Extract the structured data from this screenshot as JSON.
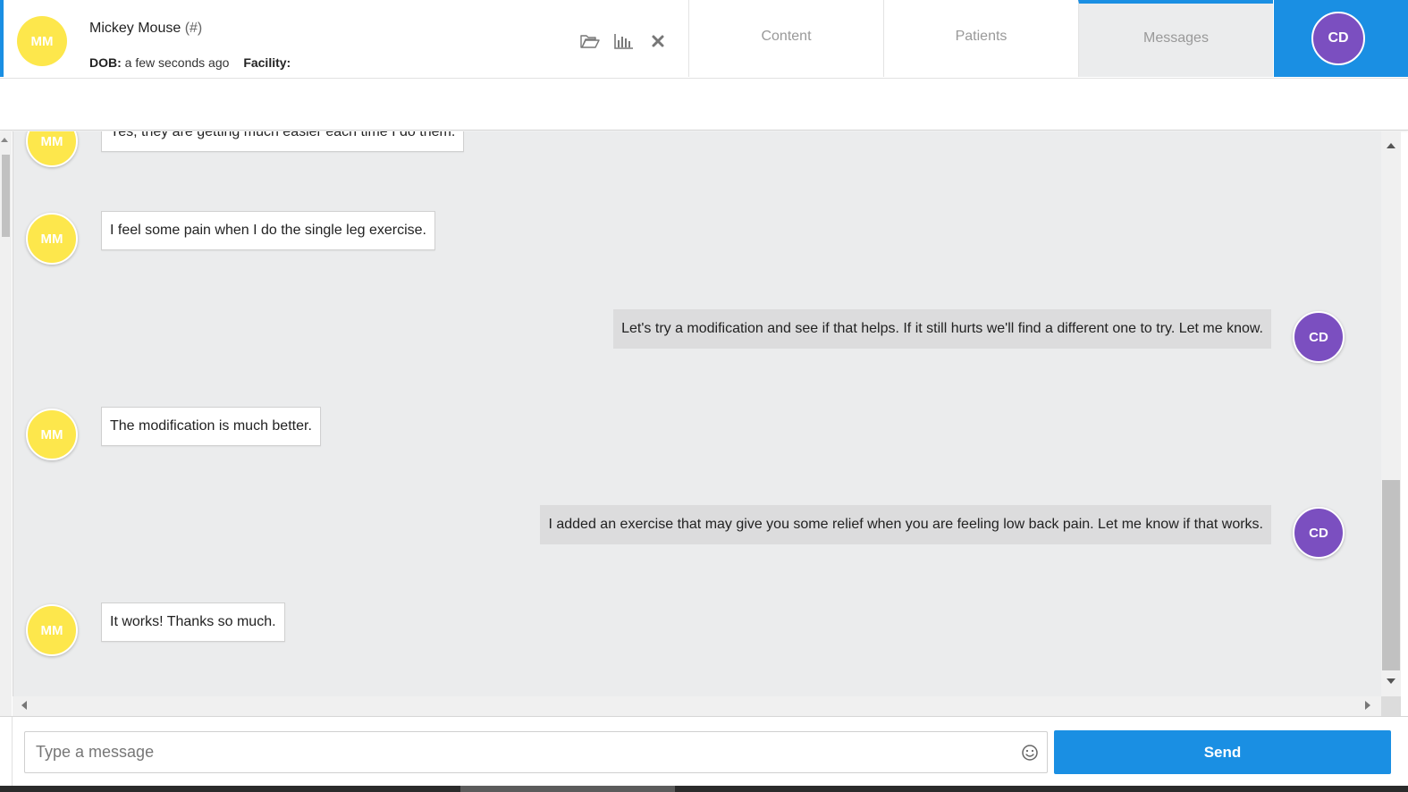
{
  "patient": {
    "initials": "MM",
    "name": "Mickey Mouse",
    "id": "(#)",
    "dob_label": "DOB:",
    "dob_value": "a few seconds ago",
    "facility_label": "Facility:"
  },
  "header_icons": [
    "folder-open-icon",
    "bar-chart-icon",
    "close-icon"
  ],
  "tabs": [
    {
      "label": "Content",
      "active": false
    },
    {
      "label": "Patients",
      "active": false
    },
    {
      "label": "Messages",
      "active": true
    }
  ],
  "user": {
    "initials": "CD"
  },
  "messages": [
    {
      "from": "MM",
      "side": "in",
      "text": "Yes, they are getting much easier each time I do them."
    },
    {
      "from": "MM",
      "side": "in",
      "text": "I feel some pain when I do the single leg exercise."
    },
    {
      "from": "CD",
      "side": "out",
      "text": "Let's try a modification and see if that helps. If it still hurts we'll find a different one to try. Let me know."
    },
    {
      "from": "MM",
      "side": "in",
      "text": "The modification is much better."
    },
    {
      "from": "CD",
      "side": "out",
      "text": "I added an exercise that may give you some relief when you are feeling low back pain. Let me know if that works."
    },
    {
      "from": "MM",
      "side": "in",
      "text": "It works! Thanks so much."
    }
  ],
  "composer": {
    "placeholder": "Type a message",
    "send_label": "Send"
  },
  "colors": {
    "accent": "#1a8fe3",
    "patient_avatar": "#fde74c",
    "user_avatar": "#7b4fc0"
  }
}
